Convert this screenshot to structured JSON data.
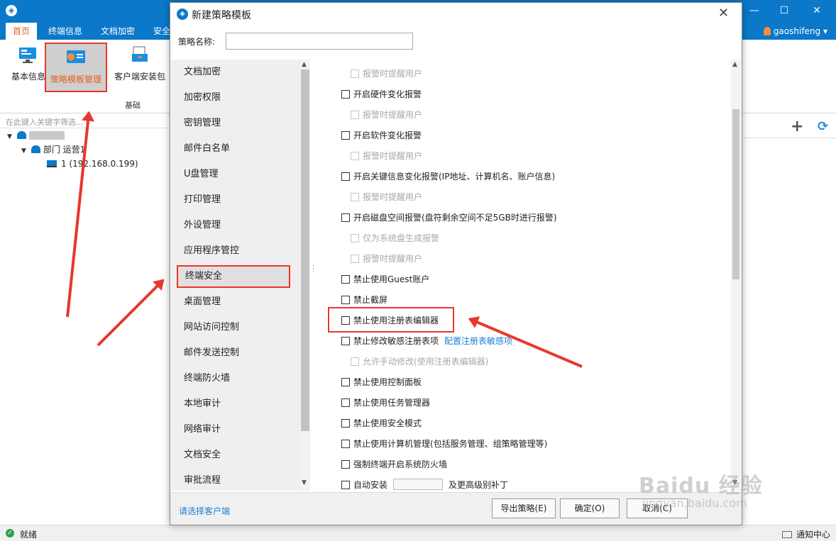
{
  "app": {
    "window_controls": {
      "minimize": "—",
      "maximize": "☐",
      "close": "✕"
    },
    "menu_tabs": [
      "首页",
      "终端信息",
      "文档加密",
      "安全"
    ],
    "user_name": "gaoshifeng"
  },
  "ribbon": {
    "items": [
      "基本信息",
      "策略模板管理",
      "客户端安装包"
    ],
    "group_label": "基础"
  },
  "search": {
    "placeholder": "在此键入关键字筛选..."
  },
  "tree": {
    "dept_label": "部门 运营1",
    "computer_label": "1 (192.168.0.199)"
  },
  "status": {
    "text": "就绪",
    "notify": "通知中心"
  },
  "dialog": {
    "title": "新建策略模板",
    "name_label": "策略名称:",
    "name_value": "",
    "categories": [
      "文档加密",
      "加密权限",
      "密钥管理",
      "邮件白名单",
      "U盘管理",
      "打印管理",
      "外设管理",
      "应用程序管控",
      "终端安全",
      "桌面管理",
      "网站访问控制",
      "邮件发送控制",
      "终端防火墙",
      "本地审计",
      "网络审计",
      "文档安全",
      "审批流程"
    ],
    "selected_category": "终端安全",
    "options": [
      {
        "label": "报警时提醒用户",
        "indent": true,
        "disabled": true
      },
      {
        "label": "开启硬件变化报警",
        "indent": false,
        "disabled": false
      },
      {
        "label": "报警时提醒用户",
        "indent": true,
        "disabled": true
      },
      {
        "label": "开启软件变化报警",
        "indent": false,
        "disabled": false
      },
      {
        "label": "报警时提醒用户",
        "indent": true,
        "disabled": true
      },
      {
        "label": "开启关键信息变化报警(IP地址、计算机名、账户信息)",
        "indent": false,
        "disabled": false
      },
      {
        "label": "报警时提醒用户",
        "indent": true,
        "disabled": true
      },
      {
        "label": "开启磁盘空间报警(盘符剩余空间不足5GB时进行报警)",
        "indent": false,
        "disabled": false
      },
      {
        "label": "仅为系统盘生成报警",
        "indent": true,
        "disabled": true
      },
      {
        "label": "报警时提醒用户",
        "indent": true,
        "disabled": true
      },
      {
        "label": "禁止使用Guest账户",
        "indent": false,
        "disabled": false
      },
      {
        "label": "禁止截屏",
        "indent": false,
        "disabled": false
      },
      {
        "label": "禁止使用注册表编辑器",
        "indent": false,
        "disabled": false
      },
      {
        "label": "禁止修改敏感注册表项",
        "indent": false,
        "disabled": false,
        "link": "配置注册表敏感项"
      },
      {
        "label": "允许手动修改(使用注册表编辑器)",
        "indent": true,
        "disabled": true
      },
      {
        "label": "禁止使用控制面板",
        "indent": false,
        "disabled": false
      },
      {
        "label": "禁止使用任务管理器",
        "indent": false,
        "disabled": false
      },
      {
        "label": "禁止使用安全模式",
        "indent": false,
        "disabled": false
      },
      {
        "label": "禁止使用计算机管理(包括服务管理、组策略管理等)",
        "indent": false,
        "disabled": false
      },
      {
        "label": "强制终端开启系统防火墙",
        "indent": false,
        "disabled": false
      },
      {
        "label": "自动安装",
        "indent": false,
        "disabled": false,
        "tail": "及更高级别补丁"
      }
    ],
    "footer_link": "请选择客户端",
    "buttons": {
      "export": "导出策略(E)",
      "ok": "确定(O)",
      "cancel": "取消(C)"
    }
  },
  "watermark": {
    "line1": "Baidu 经验",
    "line2": "jingyan.baidu.com"
  },
  "colors": {
    "brand": "#0b78c9",
    "annotation": "#e8372c",
    "link": "#1a7fd4",
    "active_tab": "#e2611e"
  }
}
